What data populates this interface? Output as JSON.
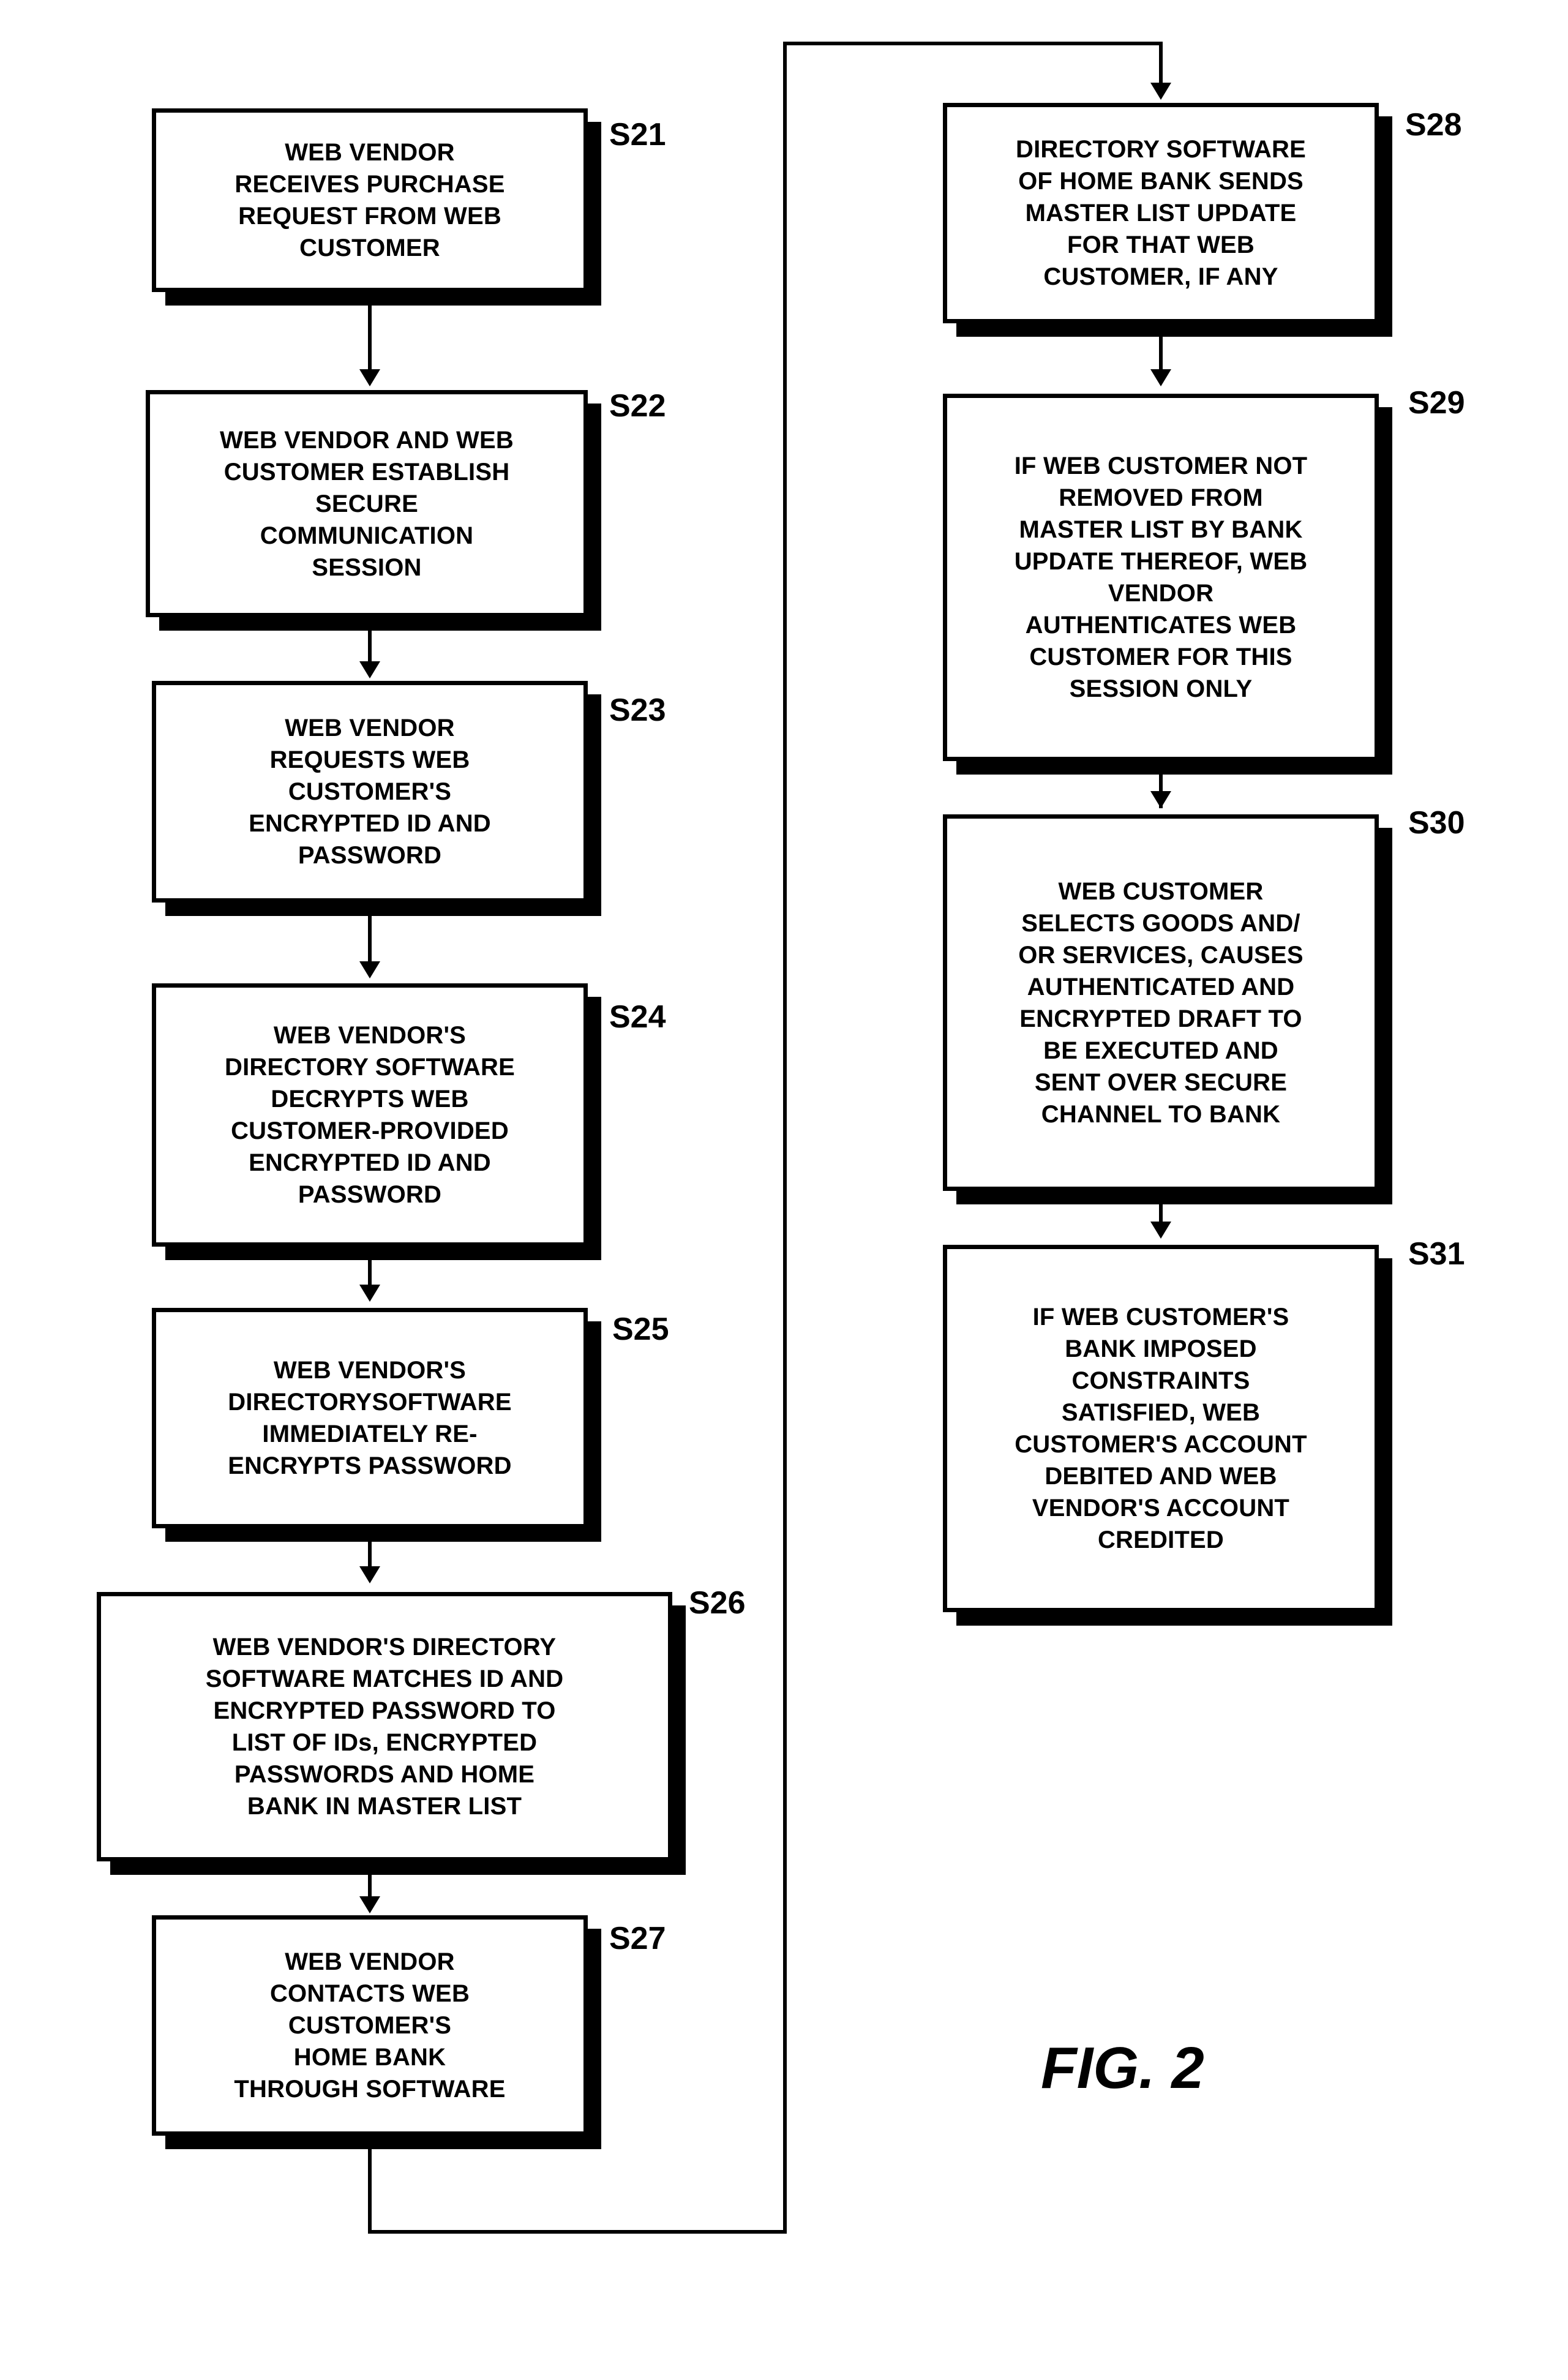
{
  "figure": {
    "caption": "FIG. 2"
  },
  "flowchart": {
    "type": "flowchart",
    "columns": 2,
    "nodes": [
      {
        "id": "S21",
        "label": "S21",
        "text": "WEB VENDOR\nRECEIVES PURCHASE\nREQUEST FROM WEB\nCUSTOMER",
        "column": "left"
      },
      {
        "id": "S22",
        "label": "S22",
        "text": "WEB VENDOR AND WEB\nCUSTOMER ESTABLISH\nSECURE\nCOMMUNICATION\nSESSION",
        "column": "left"
      },
      {
        "id": "S23",
        "label": "S23",
        "text": "WEB VENDOR\nREQUESTS WEB\nCUSTOMER'S\nENCRYPTED ID AND\nPASSWORD",
        "column": "left"
      },
      {
        "id": "S24",
        "label": "S24",
        "text": "WEB VENDOR'S\nDIRECTORY SOFTWARE\nDECRYPTS WEB\nCUSTOMER-PROVIDED\nENCRYPTED ID AND\nPASSWORD",
        "column": "left"
      },
      {
        "id": "S25",
        "label": "S25",
        "text": "WEB VENDOR'S\nDIRECTORYSOFTWARE\nIMMEDIATELY RE-\nENCRYPTS  PASSWORD",
        "column": "left"
      },
      {
        "id": "S26",
        "label": "S26",
        "text": "WEB VENDOR'S DIRECTORY\nSOFTWARE  MATCHES ID AND\nENCRYPTED  PASSWORD TO\nLIST OF IDs, ENCRYPTED\nPASSWORDS  AND HOME\nBANK IN MASTER LIST",
        "column": "left"
      },
      {
        "id": "S27",
        "label": "S27",
        "text": "WEB VENDOR\nCONTACTS WEB\nCUSTOMER'S\nHOME BANK\nTHROUGH SOFTWARE",
        "column": "left"
      },
      {
        "id": "S28",
        "label": "S28",
        "text": "DIRECTORY SOFTWARE\nOF HOME BANK SENDS\nMASTER LIST UPDATE\nFOR THAT WEB\nCUSTOMER, IF ANY",
        "column": "right"
      },
      {
        "id": "S29",
        "label": "S29",
        "text": "IF WEB CUSTOMER NOT\nREMOVED FROM\nMASTER LIST BY BANK\nUPDATE THEREOF, WEB\nVENDOR\nAUTHENTICATES WEB\nCUSTOMER FOR THIS\nSESSION ONLY",
        "column": "right"
      },
      {
        "id": "S30",
        "label": "S30",
        "text": "WEB CUSTOMER\nSELECTS GOODS AND/\nOR SERVICES, CAUSES\nAUTHENTICATED AND\nENCRYPTED DRAFT TO\nBE EXECUTED AND\nSENT OVER SECURE\nCHANNEL TO BANK",
        "column": "right"
      },
      {
        "id": "S31",
        "label": "S31",
        "text": "IF WEB CUSTOMER'S\nBANK IMPOSED\nCONSTRAINTS\nSATISFIED, WEB\nCUSTOMER'S ACCOUNT\nDEBITED AND WEB\nVENDOR'S ACCOUNT\nCREDITED",
        "column": "right"
      }
    ],
    "edges": [
      {
        "from": "S21",
        "to": "S22"
      },
      {
        "from": "S22",
        "to": "S23"
      },
      {
        "from": "S23",
        "to": "S24"
      },
      {
        "from": "S24",
        "to": "S25"
      },
      {
        "from": "S25",
        "to": "S26"
      },
      {
        "from": "S26",
        "to": "S27"
      },
      {
        "from": "S27",
        "to": "S28"
      },
      {
        "from": "S28",
        "to": "S29"
      },
      {
        "from": "S29",
        "to": "S30"
      },
      {
        "from": "S30",
        "to": "S31"
      }
    ]
  }
}
